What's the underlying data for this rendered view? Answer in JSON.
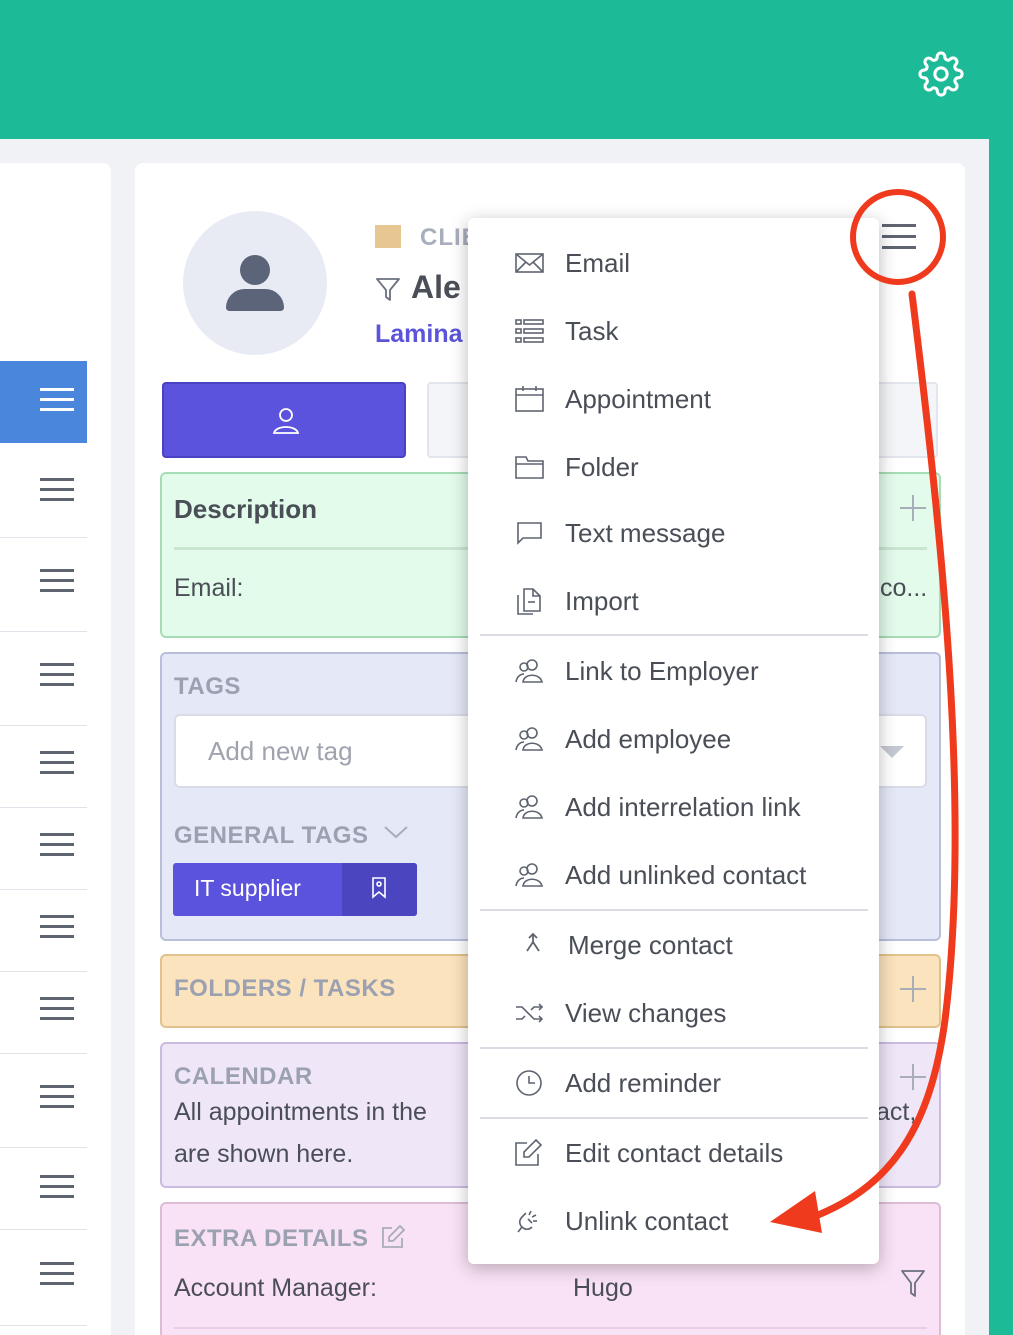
{
  "colors": {
    "teal": "#1dba97",
    "accent_purple": "#5b52dd",
    "active_blue": "#4a86dc",
    "annotation_red": "#f03a1d"
  },
  "header": {
    "settings_icon": "gear-icon"
  },
  "contact": {
    "category": "CLIE",
    "name": "Ale",
    "company": "Lamina",
    "category_color": "#e7c691"
  },
  "description": {
    "title": "Description",
    "email_label": "Email:",
    "email_value_fragment": "co..."
  },
  "tags": {
    "title": "TAGS",
    "input_placeholder": "Add new tag",
    "general_title": "GENERAL TAGS",
    "chip_label": "IT supplier"
  },
  "folders": {
    "title": "FOLDERS / TASKS"
  },
  "calendar": {
    "title": "CALENDAR",
    "line1": "All appointments in the",
    "line2": "are shown here.",
    "right_fragment": "act,"
  },
  "extra": {
    "title": "EXTRA DETAILS",
    "account_manager_label": "Account Manager:",
    "account_manager_value": "Hugo"
  },
  "menu": {
    "items": [
      {
        "label": "Email",
        "icon": "envelope-icon"
      },
      {
        "label": "Task",
        "icon": "task-list-icon"
      },
      {
        "label": "Appointment",
        "icon": "calendar-icon"
      },
      {
        "label": "Folder",
        "icon": "folder-icon"
      },
      {
        "label": "Text message",
        "icon": "chat-bubble-icon"
      },
      {
        "label": "Import",
        "icon": "import-document-icon"
      },
      {
        "label": "Link to Employer",
        "icon": "users-icon"
      },
      {
        "label": "Add employee",
        "icon": "users-icon"
      },
      {
        "label": "Add interrelation link",
        "icon": "users-icon"
      },
      {
        "label": "Add unlinked contact",
        "icon": "users-icon"
      },
      {
        "label": "Merge contact",
        "icon": "merge-icon"
      },
      {
        "label": "View changes",
        "icon": "shuffle-icon"
      },
      {
        "label": "Add reminder",
        "icon": "clock-icon"
      },
      {
        "label": "Edit contact details",
        "icon": "edit-icon"
      },
      {
        "label": "Unlink contact",
        "icon": "unlink-icon"
      }
    ]
  }
}
